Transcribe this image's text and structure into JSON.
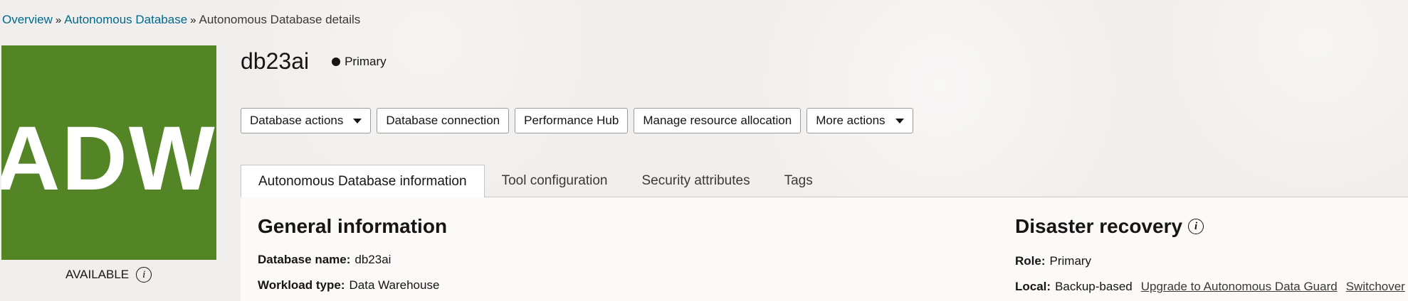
{
  "breadcrumb": {
    "items": [
      "Overview",
      "Autonomous Database"
    ],
    "separator": "»",
    "current": "Autonomous Database details"
  },
  "logo": {
    "text": "ADW",
    "color": "#538527"
  },
  "status": {
    "label": "AVAILABLE",
    "icon": "info-icon"
  },
  "header": {
    "title": "db23ai",
    "role": "Primary"
  },
  "actions": {
    "database_actions": "Database actions",
    "database_connection": "Database connection",
    "performance_hub": "Performance Hub",
    "manage_resource_allocation": "Manage resource allocation",
    "more_actions": "More actions"
  },
  "tabs": [
    {
      "label": "Autonomous Database information",
      "active": true
    },
    {
      "label": "Tool configuration",
      "active": false
    },
    {
      "label": "Security attributes",
      "active": false
    },
    {
      "label": "Tags",
      "active": false
    }
  ],
  "general_information": {
    "title": "General information",
    "database_name_label": "Database name:",
    "database_name_value": "db23ai",
    "workload_type_label": "Workload type:",
    "workload_type_value": "Data Warehouse"
  },
  "disaster_recovery": {
    "title": "Disaster recovery",
    "role_label": "Role:",
    "role_value": "Primary",
    "local_label": "Local:",
    "local_value": "Backup-based",
    "upgrade_link": "Upgrade to Autonomous Data Guard",
    "switchover_link": "Switchover"
  },
  "colors": {
    "link": "#00688c",
    "brand_green": "#538527"
  }
}
